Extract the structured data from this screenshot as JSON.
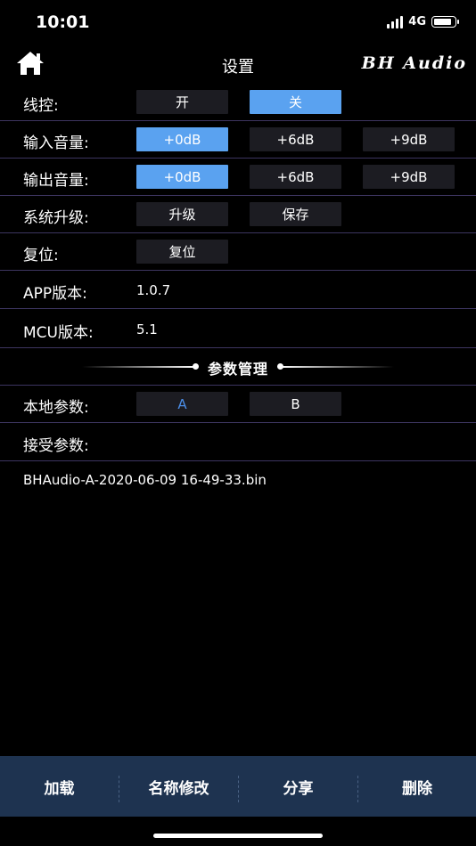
{
  "status": {
    "time": "10:01",
    "network": "4G"
  },
  "nav": {
    "title": "设置",
    "brand": "BH Audio"
  },
  "rows": {
    "wire": {
      "label": "线控:",
      "on": "开",
      "off": "关"
    },
    "input": {
      "label": "输入音量:",
      "opt0": "+0dB",
      "opt1": "+6dB",
      "opt2": "+9dB"
    },
    "output": {
      "label": "输出音量:",
      "opt0": "+0dB",
      "opt1": "+6dB",
      "opt2": "+9dB"
    },
    "upgrade": {
      "label": "系统升级:",
      "upgrade": "升级",
      "save": "保存"
    },
    "reset": {
      "label": "复位:",
      "reset": "复位"
    },
    "app": {
      "label": "APP版本:",
      "value": "1.0.7"
    },
    "mcu": {
      "label": "MCU版本:",
      "value": "5.1"
    }
  },
  "section": {
    "title": "参数管理"
  },
  "params": {
    "local": {
      "label": "本地参数:",
      "a": "A",
      "b": "B"
    },
    "receive": {
      "label": "接受参数:"
    },
    "file": "BHAudio-A-2020-06-09 16-49-33.bin"
  },
  "bottom": {
    "load": "加载",
    "rename": "名称修改",
    "share": "分享",
    "delete": "删除"
  },
  "colors": {
    "active": "#5aa2f0",
    "button": "#1c1c22",
    "bottomBar": "#1e3350",
    "divider": "#3d3560"
  }
}
